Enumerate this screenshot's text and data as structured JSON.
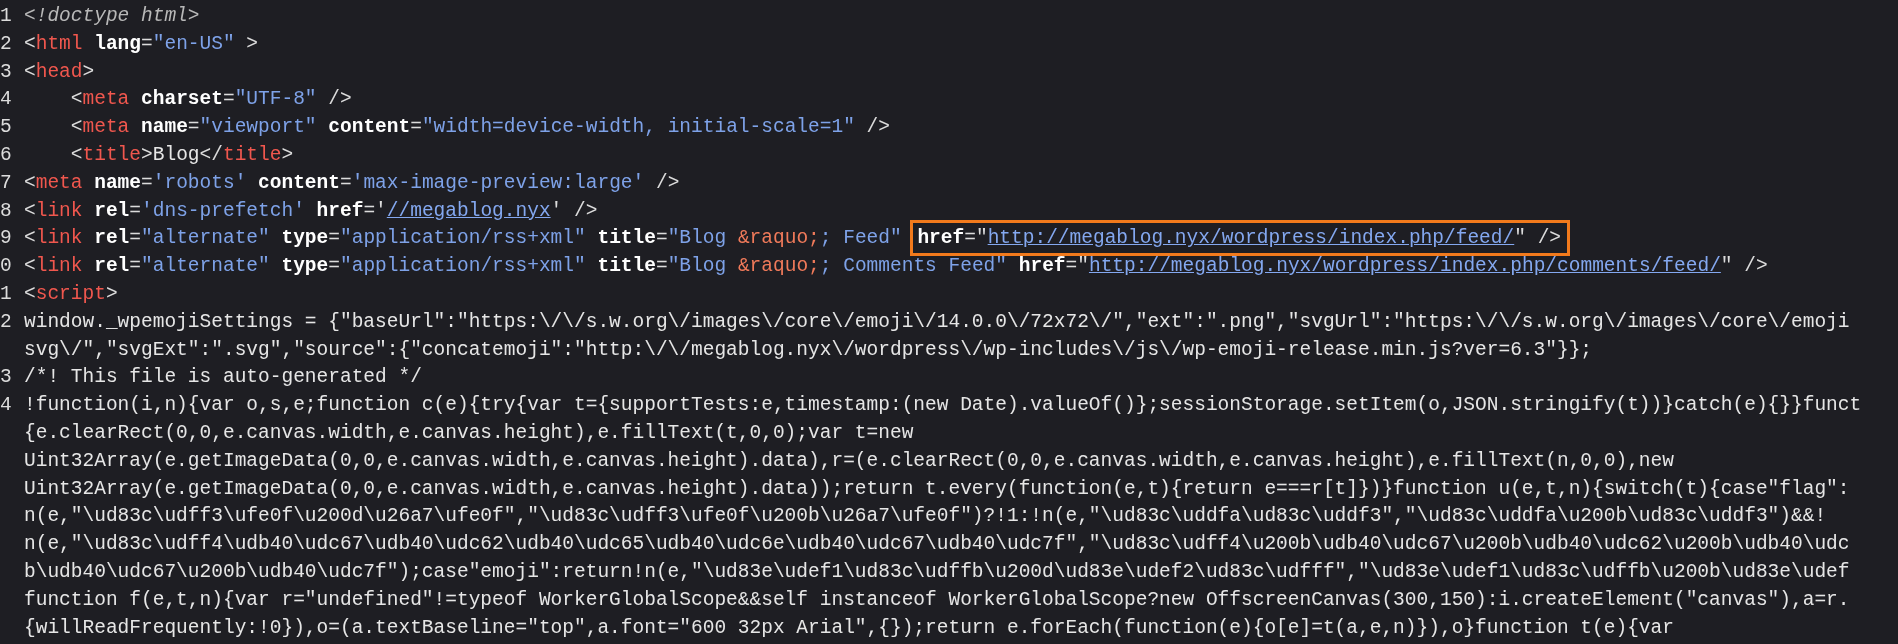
{
  "lines": [
    {
      "number": "1",
      "rows": [
        [
          {
            "kind": "doctype",
            "text": "<!doctype html>"
          }
        ]
      ]
    },
    {
      "number": "2",
      "rows": [
        [
          {
            "kind": "punct",
            "text": "<"
          },
          {
            "kind": "tag",
            "text": "html"
          },
          {
            "kind": "attr",
            "text": " lang"
          },
          {
            "kind": "punct",
            "text": "="
          },
          {
            "kind": "value",
            "text": "\"en-US\""
          },
          {
            "kind": "punct",
            "text": " >"
          }
        ]
      ]
    },
    {
      "number": "3",
      "rows": [
        [
          {
            "kind": "punct",
            "text": "<"
          },
          {
            "kind": "tag",
            "text": "head"
          },
          {
            "kind": "punct",
            "text": ">"
          }
        ]
      ]
    },
    {
      "number": "4",
      "rows": [
        [
          {
            "kind": "punct",
            "text": "    <"
          },
          {
            "kind": "tag",
            "text": "meta"
          },
          {
            "kind": "attr",
            "text": " charset"
          },
          {
            "kind": "punct",
            "text": "="
          },
          {
            "kind": "value",
            "text": "\"UTF-8\""
          },
          {
            "kind": "punct",
            "text": " />"
          }
        ]
      ]
    },
    {
      "number": "5",
      "rows": [
        [
          {
            "kind": "punct",
            "text": "    <"
          },
          {
            "kind": "tag",
            "text": "meta"
          },
          {
            "kind": "attr",
            "text": " name"
          },
          {
            "kind": "punct",
            "text": "="
          },
          {
            "kind": "value",
            "text": "\"viewport\""
          },
          {
            "kind": "attr",
            "text": " content"
          },
          {
            "kind": "punct",
            "text": "="
          },
          {
            "kind": "value",
            "text": "\"width=device-width, initial-scale=1\""
          },
          {
            "kind": "punct",
            "text": " />"
          }
        ]
      ]
    },
    {
      "number": "6",
      "rows": [
        [
          {
            "kind": "punct",
            "text": "    <"
          },
          {
            "kind": "tag",
            "text": "title"
          },
          {
            "kind": "punct",
            "text": ">"
          },
          {
            "kind": "text",
            "text": "Blog"
          },
          {
            "kind": "punct",
            "text": "</"
          },
          {
            "kind": "tag",
            "text": "title"
          },
          {
            "kind": "punct",
            "text": ">"
          }
        ]
      ]
    },
    {
      "number": "7",
      "rows": [
        [
          {
            "kind": "punct",
            "text": "<"
          },
          {
            "kind": "tag",
            "text": "meta"
          },
          {
            "kind": "attr",
            "text": " name"
          },
          {
            "kind": "punct",
            "text": "="
          },
          {
            "kind": "value",
            "text": "'robots'"
          },
          {
            "kind": "attr",
            "text": " content"
          },
          {
            "kind": "punct",
            "text": "="
          },
          {
            "kind": "value",
            "text": "'max-image-preview:large'"
          },
          {
            "kind": "punct",
            "text": " />"
          }
        ]
      ]
    },
    {
      "number": "8",
      "rows": [
        [
          {
            "kind": "punct",
            "text": "<"
          },
          {
            "kind": "tag",
            "text": "link"
          },
          {
            "kind": "attr",
            "text": " rel"
          },
          {
            "kind": "punct",
            "text": "="
          },
          {
            "kind": "value",
            "text": "'dns-prefetch'"
          },
          {
            "kind": "attr",
            "text": " href"
          },
          {
            "kind": "punct",
            "text": "='"
          },
          {
            "kind": "link",
            "text": "//megablog.nyx"
          },
          {
            "kind": "punct",
            "text": "' />"
          }
        ]
      ]
    },
    {
      "number": "9",
      "rows": [
        [
          {
            "kind": "punct",
            "text": "<"
          },
          {
            "kind": "tag",
            "text": "link"
          },
          {
            "kind": "attr",
            "text": " rel"
          },
          {
            "kind": "punct",
            "text": "="
          },
          {
            "kind": "value",
            "text": "\"alternate\""
          },
          {
            "kind": "attr",
            "text": " type"
          },
          {
            "kind": "punct",
            "text": "="
          },
          {
            "kind": "value",
            "text": "\"application/rss+xml\""
          },
          {
            "kind": "attr",
            "text": " title"
          },
          {
            "kind": "punct",
            "text": "="
          },
          {
            "kind": "value",
            "text": "\"Blog "
          },
          {
            "kind": "entity",
            "text": "&raquo;"
          },
          {
            "kind": "value",
            "text": "; Feed\" "
          },
          {
            "kind": "highlight",
            "tokens": [
              {
                "kind": "attr",
                "text": "href"
              },
              {
                "kind": "punct",
                "text": "=\""
              },
              {
                "kind": "link",
                "text": "http://megablog.nyx/wordpress/index.php/feed/"
              },
              {
                "kind": "punct",
                "text": "\" />"
              }
            ]
          }
        ]
      ]
    },
    {
      "number": "0",
      "rows": [
        [
          {
            "kind": "punct",
            "text": "<"
          },
          {
            "kind": "tag",
            "text": "link"
          },
          {
            "kind": "attr",
            "text": " rel"
          },
          {
            "kind": "punct",
            "text": "="
          },
          {
            "kind": "value",
            "text": "\"alternate\""
          },
          {
            "kind": "attr",
            "text": " type"
          },
          {
            "kind": "punct",
            "text": "="
          },
          {
            "kind": "value",
            "text": "\"application/rss+xml\""
          },
          {
            "kind": "attr",
            "text": " title"
          },
          {
            "kind": "punct",
            "text": "="
          },
          {
            "kind": "value",
            "text": "\"Blog "
          },
          {
            "kind": "entity",
            "text": "&raquo;"
          },
          {
            "kind": "value",
            "text": "; Comments Feed\""
          },
          {
            "kind": "attr",
            "text": " href"
          },
          {
            "kind": "punct",
            "text": "=\""
          },
          {
            "kind": "link",
            "text": "http://megablog.nyx/wordpress/index.php/comments/feed/"
          },
          {
            "kind": "punct",
            "text": "\" />"
          }
        ]
      ]
    },
    {
      "number": "1",
      "rows": [
        [
          {
            "kind": "punct",
            "text": "<"
          },
          {
            "kind": "tag",
            "text": "script"
          },
          {
            "kind": "punct",
            "text": ">"
          }
        ]
      ]
    },
    {
      "number": "2",
      "rows": [
        [
          {
            "kind": "text",
            "text": "window._wpemojiSettings = {\"baseUrl\":\"https:\\/\\/s.w.org\\/images\\/core\\/emoji\\/14.0.0\\/72x72\\/\",\"ext\":\".png\",\"svgUrl\":\"https:\\/\\/s.w.org\\/images\\/core\\/emoji"
          }
        ],
        [
          {
            "kind": "text",
            "text": "svg\\/\",\"svgExt\":\".svg\",\"source\":{\"concatemoji\":\"http:\\/\\/megablog.nyx\\/wordpress\\/wp-includes\\/js\\/wp-emoji-release.min.js?ver=6.3\"}};"
          }
        ]
      ]
    },
    {
      "number": "3",
      "rows": [
        [
          {
            "kind": "text",
            "text": "/*! This file is auto-generated */"
          }
        ]
      ]
    },
    {
      "number": "4",
      "rows": [
        [
          {
            "kind": "text",
            "text": "!function(i,n){var o,s,e;function c(e){try{var t={supportTests:e,timestamp:(new Date).valueOf()};sessionStorage.setItem(o,JSON.stringify(t))}catch(e){}}funct"
          }
        ],
        [
          {
            "kind": "text",
            "text": "{e.clearRect(0,0,e.canvas.width,e.canvas.height),e.fillText(t,0,0);var t=new"
          }
        ],
        [
          {
            "kind": "text",
            "text": "Uint32Array(e.getImageData(0,0,e.canvas.width,e.canvas.height).data),r=(e.clearRect(0,0,e.canvas.width,e.canvas.height),e.fillText(n,0,0),new"
          }
        ],
        [
          {
            "kind": "text",
            "text": "Uint32Array(e.getImageData(0,0,e.canvas.width,e.canvas.height).data));return t.every(function(e,t){return e===r[t]})}function u(e,t,n){switch(t){case\"flag\":"
          }
        ],
        [
          {
            "kind": "text",
            "text": "n(e,\"\\ud83c\\udff3\\ufe0f\\u200d\\u26a7\\ufe0f\",\"\\ud83c\\udff3\\ufe0f\\u200b\\u26a7\\ufe0f\")?!1:!n(e,\"\\ud83c\\uddfa\\ud83c\\uddf3\",\"\\ud83c\\uddfa\\u200b\\ud83c\\uddf3\")&&!"
          }
        ],
        [
          {
            "kind": "text",
            "text": "n(e,\"\\ud83c\\udff4\\udb40\\udc67\\udb40\\udc62\\udb40\\udc65\\udb40\\udc6e\\udb40\\udc67\\udb40\\udc7f\",\"\\ud83c\\udff4\\u200b\\udb40\\udc67\\u200b\\udb40\\udc62\\u200b\\udb40\\udc"
          }
        ],
        [
          {
            "kind": "text",
            "text": "b\\udb40\\udc67\\u200b\\udb40\\udc7f\");case\"emoji\":return!n(e,\"\\ud83e\\udef1\\ud83c\\udffb\\u200d\\ud83e\\udef2\\ud83c\\udfff\",\"\\ud83e\\udef1\\ud83c\\udffb\\u200b\\ud83e\\udef"
          }
        ],
        [
          {
            "kind": "text",
            "text": "function f(e,t,n){var r=\"undefined\"!=typeof WorkerGlobalScope&&self instanceof WorkerGlobalScope?new OffscreenCanvas(300,150):i.createElement(\"canvas\"),a=r."
          }
        ],
        [
          {
            "kind": "text",
            "text": "{willReadFrequently:!0}),o=(a.textBaseline=\"top\",a.font=\"600 32px Arial\",{});return e.forEach(function(e){o[e]=t(a,e,n)}),o}function t(e){var"
          }
        ]
      ]
    }
  ]
}
